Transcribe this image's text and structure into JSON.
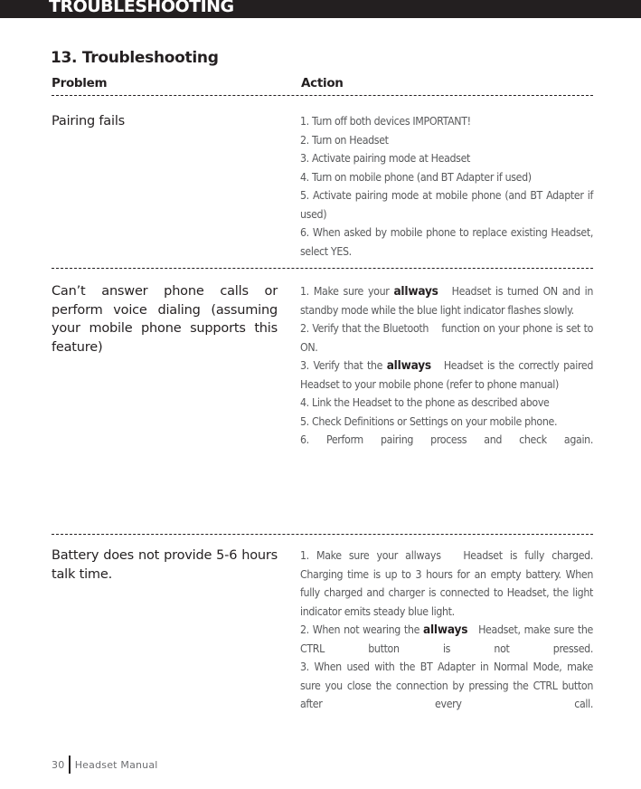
{
  "header": {
    "title": "TROUBLESHOOTING",
    "bar_color": "#231f20"
  },
  "section": {
    "title": "13. Troubleshooting"
  },
  "table": {
    "columns": {
      "problem": "Problem",
      "action": "Action"
    },
    "rows": [
      {
        "problem": "Pairing fails",
        "steps": [
          {
            "text": "1. Turn off both devices IMPORTANT!"
          },
          {
            "text": "2. Turn on Headset"
          },
          {
            "text": "3. Activate pairing mode at Headset"
          },
          {
            "text": "4. Turn on mobile phone (and  BT Adapter if used)"
          },
          {
            "text": "5. Activate pairing mode at mobile phone (and BT Adapter if used)"
          },
          {
            "text": "6. When asked by mobile phone to replace existing Headset, select YES."
          }
        ]
      },
      {
        "problem": "Can’t answer phone calls or perform voice dialing (assuming your mobile phone supports this feature)",
        "steps": [
          {
            "before": "1. Make sure your ",
            "brand": "allways",
            "after": "   Headset is turned ON and in standby mode while the blue light indicator flashes slowly."
          },
          {
            "text": "2. Verify that the Bluetooth    function on your phone is set to ON."
          },
          {
            "before": "3. Verify that the ",
            "brand": "allways",
            "after": "   Headset is the correctly paired Headset to your mobile phone (refer to phone manual)"
          },
          {
            "text": "4. Link the Headset to the phone as described above"
          },
          {
            "text": "5. Check Definitions or Settings on your mobile phone."
          },
          {
            "text": "6. Perform pairing process and check again."
          }
        ]
      },
      {
        "problem": "Battery does not provide 5-6 hours talk time.",
        "steps": [
          {
            "before": "1. Make sure your ",
            "brand_plain": "allways",
            "after": "   Headset is fully charged. Charging time is up to 3 hours for an empty battery. When fully charged and charger is connected to Headset, the light indicator emits steady blue light."
          },
          {
            "before": "2. When not wearing the ",
            "brand": "allways",
            "after": "   Headset, make sure the CTRL button is not pressed."
          },
          {
            "text": "3. When used with the BT Adapter in Normal Mode, make sure you close the connection by pressing the CTRL button after every call."
          }
        ]
      }
    ]
  },
  "footer": {
    "page_number": "30",
    "label": "Headset Manual"
  }
}
